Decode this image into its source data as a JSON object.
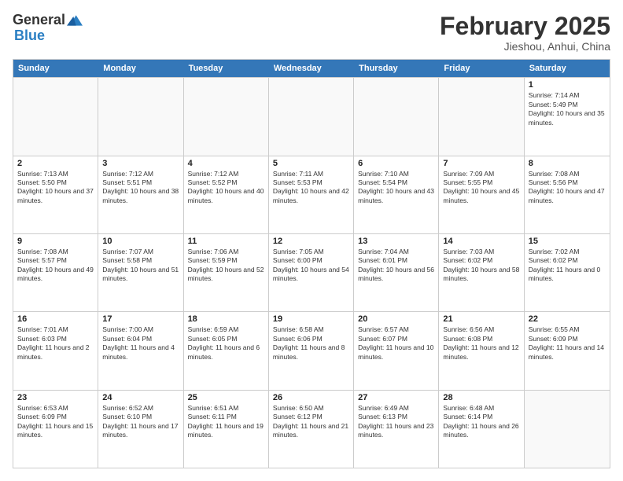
{
  "logo": {
    "general": "General",
    "blue": "Blue"
  },
  "title": {
    "month_year": "February 2025",
    "location": "Jieshou, Anhui, China"
  },
  "header_days": [
    "Sunday",
    "Monday",
    "Tuesday",
    "Wednesday",
    "Thursday",
    "Friday",
    "Saturday"
  ],
  "weeks": [
    [
      {
        "day": "",
        "info": ""
      },
      {
        "day": "",
        "info": ""
      },
      {
        "day": "",
        "info": ""
      },
      {
        "day": "",
        "info": ""
      },
      {
        "day": "",
        "info": ""
      },
      {
        "day": "",
        "info": ""
      },
      {
        "day": "1",
        "info": "Sunrise: 7:14 AM\nSunset: 5:49 PM\nDaylight: 10 hours and 35 minutes."
      }
    ],
    [
      {
        "day": "2",
        "info": "Sunrise: 7:13 AM\nSunset: 5:50 PM\nDaylight: 10 hours and 37 minutes."
      },
      {
        "day": "3",
        "info": "Sunrise: 7:12 AM\nSunset: 5:51 PM\nDaylight: 10 hours and 38 minutes."
      },
      {
        "day": "4",
        "info": "Sunrise: 7:12 AM\nSunset: 5:52 PM\nDaylight: 10 hours and 40 minutes."
      },
      {
        "day": "5",
        "info": "Sunrise: 7:11 AM\nSunset: 5:53 PM\nDaylight: 10 hours and 42 minutes."
      },
      {
        "day": "6",
        "info": "Sunrise: 7:10 AM\nSunset: 5:54 PM\nDaylight: 10 hours and 43 minutes."
      },
      {
        "day": "7",
        "info": "Sunrise: 7:09 AM\nSunset: 5:55 PM\nDaylight: 10 hours and 45 minutes."
      },
      {
        "day": "8",
        "info": "Sunrise: 7:08 AM\nSunset: 5:56 PM\nDaylight: 10 hours and 47 minutes."
      }
    ],
    [
      {
        "day": "9",
        "info": "Sunrise: 7:08 AM\nSunset: 5:57 PM\nDaylight: 10 hours and 49 minutes."
      },
      {
        "day": "10",
        "info": "Sunrise: 7:07 AM\nSunset: 5:58 PM\nDaylight: 10 hours and 51 minutes."
      },
      {
        "day": "11",
        "info": "Sunrise: 7:06 AM\nSunset: 5:59 PM\nDaylight: 10 hours and 52 minutes."
      },
      {
        "day": "12",
        "info": "Sunrise: 7:05 AM\nSunset: 6:00 PM\nDaylight: 10 hours and 54 minutes."
      },
      {
        "day": "13",
        "info": "Sunrise: 7:04 AM\nSunset: 6:01 PM\nDaylight: 10 hours and 56 minutes."
      },
      {
        "day": "14",
        "info": "Sunrise: 7:03 AM\nSunset: 6:02 PM\nDaylight: 10 hours and 58 minutes."
      },
      {
        "day": "15",
        "info": "Sunrise: 7:02 AM\nSunset: 6:02 PM\nDaylight: 11 hours and 0 minutes."
      }
    ],
    [
      {
        "day": "16",
        "info": "Sunrise: 7:01 AM\nSunset: 6:03 PM\nDaylight: 11 hours and 2 minutes."
      },
      {
        "day": "17",
        "info": "Sunrise: 7:00 AM\nSunset: 6:04 PM\nDaylight: 11 hours and 4 minutes."
      },
      {
        "day": "18",
        "info": "Sunrise: 6:59 AM\nSunset: 6:05 PM\nDaylight: 11 hours and 6 minutes."
      },
      {
        "day": "19",
        "info": "Sunrise: 6:58 AM\nSunset: 6:06 PM\nDaylight: 11 hours and 8 minutes."
      },
      {
        "day": "20",
        "info": "Sunrise: 6:57 AM\nSunset: 6:07 PM\nDaylight: 11 hours and 10 minutes."
      },
      {
        "day": "21",
        "info": "Sunrise: 6:56 AM\nSunset: 6:08 PM\nDaylight: 11 hours and 12 minutes."
      },
      {
        "day": "22",
        "info": "Sunrise: 6:55 AM\nSunset: 6:09 PM\nDaylight: 11 hours and 14 minutes."
      }
    ],
    [
      {
        "day": "23",
        "info": "Sunrise: 6:53 AM\nSunset: 6:09 PM\nDaylight: 11 hours and 15 minutes."
      },
      {
        "day": "24",
        "info": "Sunrise: 6:52 AM\nSunset: 6:10 PM\nDaylight: 11 hours and 17 minutes."
      },
      {
        "day": "25",
        "info": "Sunrise: 6:51 AM\nSunset: 6:11 PM\nDaylight: 11 hours and 19 minutes."
      },
      {
        "day": "26",
        "info": "Sunrise: 6:50 AM\nSunset: 6:12 PM\nDaylight: 11 hours and 21 minutes."
      },
      {
        "day": "27",
        "info": "Sunrise: 6:49 AM\nSunset: 6:13 PM\nDaylight: 11 hours and 23 minutes."
      },
      {
        "day": "28",
        "info": "Sunrise: 6:48 AM\nSunset: 6:14 PM\nDaylight: 11 hours and 26 minutes."
      },
      {
        "day": "",
        "info": ""
      }
    ]
  ]
}
